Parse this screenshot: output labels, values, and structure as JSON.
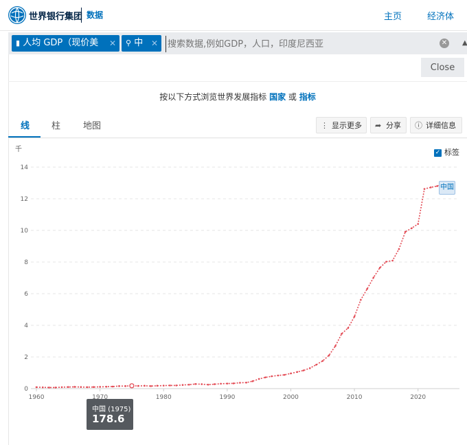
{
  "header": {
    "brand": "世界银行集团",
    "brand_sub": "数据",
    "nav_home": "主页",
    "nav_economy": "经济体"
  },
  "search": {
    "chip_indicator": "人均 GDP（现价美元）",
    "chip_country": "中国",
    "placeholder": "搜索数据,例如GDP，人口，印度尼西亚"
  },
  "close_label": "Close",
  "browse": {
    "prefix": "按以下方式浏览世界发展指标",
    "country_link": "国家",
    "or": "或",
    "indicator_link": "指标"
  },
  "tabs": [
    {
      "label": "线"
    },
    {
      "label": "柱"
    },
    {
      "label": "地图"
    }
  ],
  "tools": {
    "more": "显示更多",
    "share": "分享",
    "details": "详细信息"
  },
  "label_toggle": "标签",
  "series_tag": "中国",
  "tooltip": {
    "title": "中国 (1975)",
    "value": "178.6"
  },
  "colors": {
    "accent": "#0071bc",
    "series": "#e34a54"
  },
  "chart_data": {
    "type": "line",
    "ylabel": "千",
    "ylim": [
      0,
      14
    ],
    "xlim": [
      1960,
      2025
    ],
    "y_ticks": [
      0,
      2,
      4,
      6,
      8,
      10,
      12,
      14
    ],
    "x_ticks": [
      1960,
      1970,
      1980,
      1990,
      2000,
      2010,
      2020
    ],
    "series": [
      {
        "name": "中国",
        "x": [
          1960,
          1961,
          1962,
          1963,
          1964,
          1965,
          1966,
          1967,
          1968,
          1969,
          1970,
          1971,
          1972,
          1973,
          1974,
          1975,
          1976,
          1977,
          1978,
          1979,
          1980,
          1981,
          1982,
          1983,
          1984,
          1985,
          1986,
          1987,
          1988,
          1989,
          1990,
          1991,
          1992,
          1993,
          1994,
          1995,
          1996,
          1997,
          1998,
          1999,
          2000,
          2001,
          2002,
          2003,
          2004,
          2005,
          2006,
          2007,
          2008,
          2009,
          2010,
          2011,
          2012,
          2013,
          2014,
          2015,
          2016,
          2017,
          2018,
          2019,
          2020,
          2021,
          2022,
          2023,
          2024
        ],
        "values": [
          0.09,
          0.08,
          0.07,
          0.07,
          0.09,
          0.1,
          0.11,
          0.1,
          0.09,
          0.1,
          0.11,
          0.12,
          0.13,
          0.16,
          0.16,
          0.1786,
          0.17,
          0.18,
          0.16,
          0.18,
          0.19,
          0.2,
          0.2,
          0.23,
          0.25,
          0.29,
          0.28,
          0.25,
          0.28,
          0.31,
          0.32,
          0.33,
          0.37,
          0.38,
          0.47,
          0.61,
          0.71,
          0.78,
          0.83,
          0.87,
          0.96,
          1.05,
          1.15,
          1.29,
          1.51,
          1.75,
          2.1,
          2.69,
          3.47,
          3.83,
          4.55,
          5.61,
          6.3,
          7.02,
          7.64,
          8.02,
          8.09,
          8.82,
          9.91,
          10.14,
          10.41,
          12.62,
          12.72,
          12.8,
          13.0
        ]
      }
    ],
    "highlight": {
      "x": 1975,
      "value": 178.6
    }
  }
}
